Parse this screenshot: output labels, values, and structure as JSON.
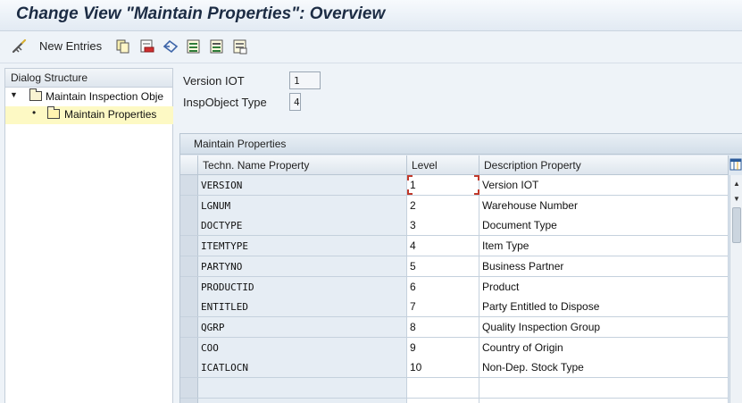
{
  "window": {
    "title": "Change View \"Maintain Properties\": Overview"
  },
  "toolbar": {
    "new_entries_label": "New Entries",
    "icons": [
      "change-display-icon",
      "copy-as-icon",
      "delete-icon",
      "undo-icon",
      "select-all-icon",
      "select-block-icon",
      "deselect-all-icon"
    ]
  },
  "dialog_structure": {
    "header": "Dialog Structure",
    "items": [
      {
        "label": "Maintain Inspection Obje",
        "expanded": true
      },
      {
        "label": "Maintain Properties",
        "selected": true
      }
    ]
  },
  "header_fields": {
    "version_label": "Version IOT",
    "version_value": "1",
    "type_label": "InspObject Type",
    "type_value": "4"
  },
  "table": {
    "title": "Maintain Properties",
    "columns": [
      "Techn. Name Property",
      "Level",
      "Description Property"
    ],
    "rows": [
      {
        "name": "VERSION",
        "level": "1",
        "desc": "Version IOT"
      },
      {
        "name": "LGNUM",
        "level": "2",
        "desc": "Warehouse Number"
      },
      {
        "name": "DOCTYPE",
        "level": "3",
        "desc": "Document Type"
      },
      {
        "name": "ITEMTYPE",
        "level": "4",
        "desc": "Item Type"
      },
      {
        "name": "PARTYNO",
        "level": "5",
        "desc": "Business Partner"
      },
      {
        "name": "PRODUCTID",
        "level": "6",
        "desc": "Product"
      },
      {
        "name": "ENTITLED",
        "level": "7",
        "desc": "Party Entitled to Dispose"
      },
      {
        "name": "QGRP",
        "level": "8",
        "desc": "Quality Inspection Group"
      },
      {
        "name": "COO",
        "level": "9",
        "desc": "Country of Origin"
      },
      {
        "name": "ICATLOCN",
        "level": "10",
        "desc": "Non-Dep. Stock Type"
      },
      {
        "name": "",
        "level": "",
        "desc": ""
      },
      {
        "name": "",
        "level": "",
        "desc": ""
      }
    ]
  },
  "colors": {
    "title_text": "#1c2c44",
    "selection": "#fdf9c4",
    "focus": "#c0392b"
  }
}
